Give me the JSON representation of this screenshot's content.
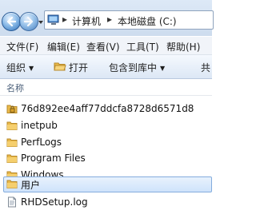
{
  "address_bar": {
    "segments": [
      "计算机",
      "本地磁盘 (C:)"
    ],
    "separator": "▸"
  },
  "menu": {
    "items": [
      "文件(F)",
      "编辑(E)",
      "查看(V)",
      "工具(T)",
      "帮助(H)"
    ]
  },
  "toolbar": {
    "organize_label": "组织",
    "open_label": "打开",
    "include_library_label": "包含到库中",
    "share_label": "共"
  },
  "list": {
    "column_name": "名称",
    "items": [
      {
        "name": "76d892ee4aff77ddcfa8728d6571d8",
        "icon": "locked-folder-icon"
      },
      {
        "name": "inetpub",
        "icon": "folder-icon"
      },
      {
        "name": "PerfLogs",
        "icon": "folder-icon"
      },
      {
        "name": "Program Files",
        "icon": "folder-icon"
      },
      {
        "name": "Windows",
        "icon": "folder-icon"
      },
      {
        "name": "用户",
        "icon": "folder-icon",
        "selected": true
      },
      {
        "name": "RHDSetup.log",
        "icon": "log-file-icon"
      }
    ]
  },
  "colors": {
    "selection_border": "#84acdd",
    "folder_yellow": "#e9b94a",
    "toolbar_bg": "#dce7f5"
  }
}
